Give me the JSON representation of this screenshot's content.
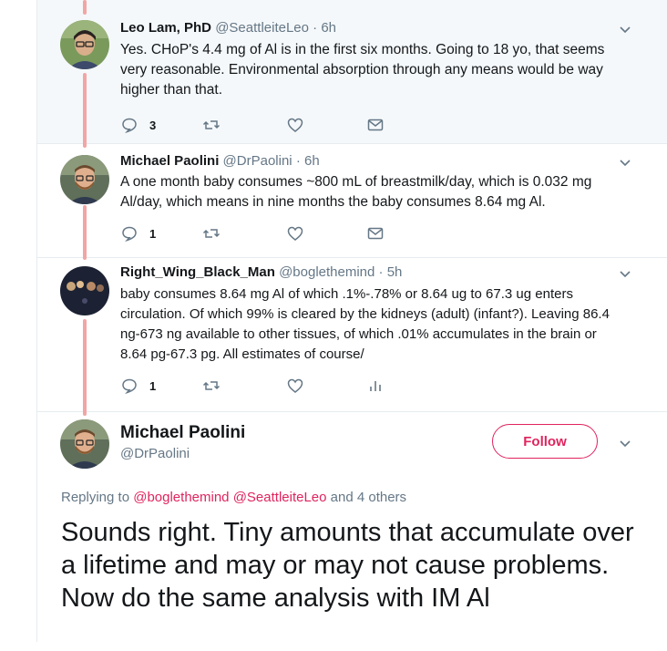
{
  "tweets": [
    {
      "name": "Leo Lam, PhD",
      "handle": "@SeattleiteLeo",
      "time": "· 6h",
      "text": "Yes. CHoP's 4.4 mg of Al is in the first six months. Going to 18 yo, that seems very reasonable. Environmental absorption through any means would be way higher than that.",
      "reply_count": "3",
      "last_action_icon": "envelope-icon"
    },
    {
      "name": "Michael Paolini",
      "handle": "@DrPaolini",
      "time": "· 6h",
      "text": "A one month baby consumes ~800 mL of breastmilk/day, which is 0.032 mg Al/day, which means in nine months the baby consumes 8.64 mg Al.",
      "reply_count": "1",
      "last_action_icon": "envelope-icon"
    },
    {
      "name": "Right_Wing_Black_Man",
      "handle": "@boglethemind",
      "time": "· 5h",
      "text": "baby consumes 8.64 mg Al of which .1%-.78% or 8.64 ug to 67.3 ug enters circulation.  Of which 99% is cleared by the kidneys (adult) (infant?).  Leaving 86.4 ng-673 ng available to other tissues, of which .01% accumulates in the brain or 8.64 pg-67.3 pg.  All estimates of course/",
      "reply_count": "1",
      "last_action_icon": "analytics-icon"
    }
  ],
  "main_tweet": {
    "name": "Michael Paolini",
    "handle": "@DrPaolini",
    "follow_label": "Follow",
    "replying_prefix": "Replying to",
    "replying_mention_1": "@boglethemind",
    "replying_mention_2": "@SeattleiteLeo",
    "replying_suffix": "and 4 others",
    "text": "Sounds right. Tiny amounts that accumulate over a lifetime and may or may not cause problems. Now do the same analysis with IM Al"
  },
  "colors": {
    "thread_line": "#f2a5a5",
    "accent": "#e0245e",
    "muted": "#657786",
    "shaded_bg": "#f5f8fa"
  }
}
